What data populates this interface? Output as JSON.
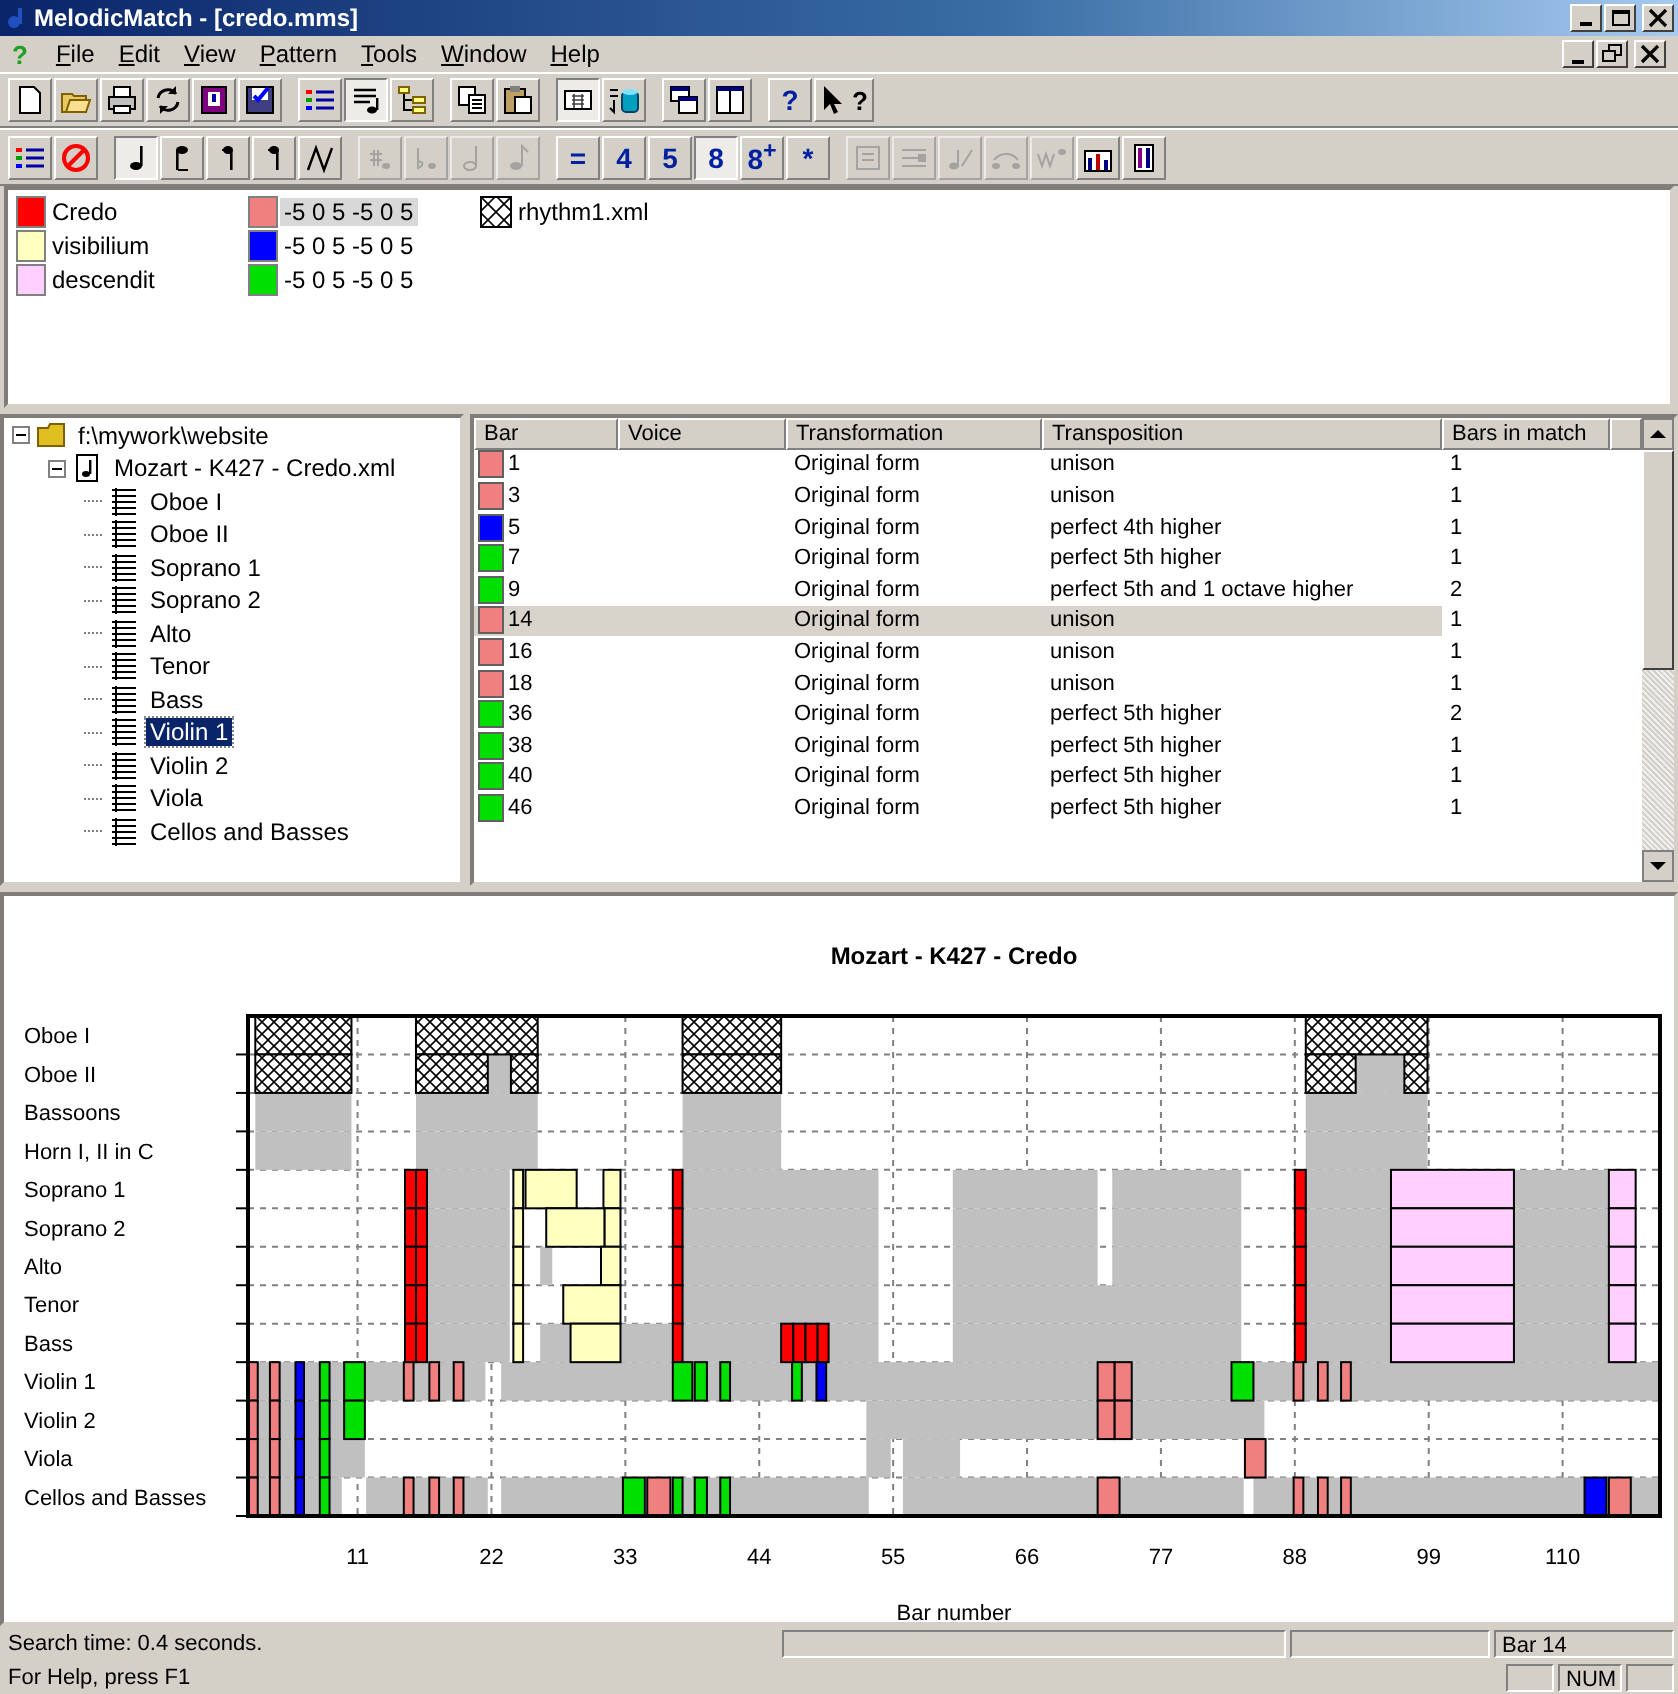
{
  "window": {
    "title": "MelodicMatch - [credo.mms]"
  },
  "menu": {
    "app_glyph": "?",
    "items": [
      "File",
      "Edit",
      "View",
      "Pattern",
      "Tools",
      "Window",
      "Help"
    ]
  },
  "toolbars": [
    [
      [
        {
          "kind": "new",
          "pressed": false,
          "disabled": false
        },
        {
          "kind": "open",
          "pressed": false,
          "disabled": false
        },
        {
          "kind": "print",
          "pressed": false,
          "disabled": false
        },
        {
          "kind": "refresh",
          "pressed": false,
          "disabled": false
        },
        {
          "kind": "helpbook",
          "pressed": false,
          "disabled": false
        },
        {
          "kind": "save",
          "pressed": false,
          "disabled": false
        }
      ],
      [
        {
          "kind": "colorlist",
          "pressed": false,
          "disabled": false
        },
        {
          "kind": "notelist",
          "pressed": true,
          "disabled": false
        },
        {
          "kind": "tree",
          "pressed": false,
          "disabled": false
        }
      ],
      [
        {
          "kind": "copy",
          "pressed": false,
          "disabled": false
        },
        {
          "kind": "paste",
          "pressed": false,
          "disabled": false
        }
      ],
      [
        {
          "kind": "grid",
          "pressed": true,
          "disabled": false
        },
        {
          "kind": "database",
          "pressed": false,
          "disabled": false
        }
      ],
      [
        {
          "kind": "cascade",
          "pressed": false,
          "disabled": false
        },
        {
          "kind": "tile",
          "pressed": false,
          "disabled": false
        }
      ],
      [
        {
          "kind": "text",
          "label": "?",
          "pressed": false,
          "disabled": false
        },
        {
          "kind": "whatsthis",
          "label": "?",
          "pressed": false,
          "disabled": false
        }
      ]
    ],
    [
      [
        {
          "kind": "colorlist",
          "pressed": false,
          "disabled": false
        },
        {
          "kind": "nosign",
          "pressed": false,
          "disabled": false
        }
      ],
      [
        {
          "kind": "quarter",
          "pressed": true,
          "disabled": false
        },
        {
          "kind": "notedown",
          "pressed": false,
          "disabled": false
        },
        {
          "kind": "noteflag",
          "pressed": false,
          "disabled": false
        },
        {
          "kind": "noteflag",
          "pressed": false,
          "disabled": false
        },
        {
          "kind": "zigzag",
          "pressed": false,
          "disabled": false
        }
      ],
      [
        {
          "kind": "sharp",
          "pressed": false,
          "disabled": true
        },
        {
          "kind": "flat",
          "pressed": false,
          "disabled": true
        },
        {
          "kind": "half",
          "pressed": false,
          "disabled": true
        },
        {
          "kind": "eighth",
          "pressed": false,
          "disabled": true
        }
      ],
      [
        {
          "kind": "text",
          "label": "=",
          "pressed": false,
          "disabled": false
        },
        {
          "kind": "text",
          "label": "4",
          "pressed": false,
          "disabled": false
        },
        {
          "kind": "text",
          "label": "5",
          "pressed": false,
          "disabled": false
        },
        {
          "kind": "text",
          "label": "8",
          "pressed": true,
          "disabled": false
        },
        {
          "kind": "text",
          "label": "8$^{+}$",
          "pressed": false,
          "disabled": false
        },
        {
          "kind": "text",
          "label": "*",
          "pressed": false,
          "disabled": false
        }
      ],
      [
        {
          "kind": "card",
          "pressed": false,
          "disabled": true
        },
        {
          "kind": "lines",
          "pressed": false,
          "disabled": true
        },
        {
          "kind": "notex",
          "pressed": false,
          "disabled": true
        },
        {
          "kind": "tie",
          "pressed": false,
          "disabled": true
        },
        {
          "kind": "wave",
          "pressed": false,
          "disabled": true
        },
        {
          "kind": "bars",
          "pressed": false,
          "disabled": false
        },
        {
          "kind": "bars2",
          "pressed": false,
          "disabled": false
        }
      ]
    ]
  ],
  "legend": [
    [
      {
        "kind": "swatch",
        "label": "Credo",
        "color": "#ff0000",
        "selected": false
      },
      {
        "kind": "swatch",
        "label": "visibilium",
        "color": "#ffffc0",
        "selected": false
      },
      {
        "kind": "swatch",
        "label": "descendit",
        "color": "#ffd0ff",
        "selected": false
      }
    ],
    [
      {
        "kind": "swatch",
        "label": "-5 0 5 -5 0 5",
        "color": "#f08080",
        "selected": true
      },
      {
        "kind": "swatch",
        "label": "-5 0 5 -5 0 5",
        "color": "#0000ff",
        "selected": false
      },
      {
        "kind": "swatch",
        "label": "-5 0 5 -5 0 5",
        "color": "#00e000",
        "selected": false
      }
    ],
    [
      {
        "kind": "hatch",
        "label": "rhythm1.xml",
        "selected": false
      }
    ]
  ],
  "tree": [
    {
      "kind": "folder",
      "label": "f:\\mywork\\website",
      "expanded": true,
      "selected": false,
      "children": [
        {
          "kind": "score",
          "label": "Mozart - K427 - Credo.xml",
          "expanded": true,
          "selected": false,
          "children": [
            {
              "kind": "part",
              "label": "Oboe I",
              "selected": false
            },
            {
              "kind": "part",
              "label": "Oboe II",
              "selected": false
            },
            {
              "kind": "part",
              "label": "Soprano 1",
              "selected": false
            },
            {
              "kind": "part",
              "label": "Soprano 2",
              "selected": false
            },
            {
              "kind": "part",
              "label": "Alto",
              "selected": false
            },
            {
              "kind": "part",
              "label": "Tenor",
              "selected": false
            },
            {
              "kind": "part",
              "label": "Bass",
              "selected": false
            },
            {
              "kind": "part",
              "label": "Violin 1",
              "selected": true
            },
            {
              "kind": "part",
              "label": "Violin 2",
              "selected": false
            },
            {
              "kind": "part",
              "label": "Viola",
              "selected": false
            },
            {
              "kind": "part",
              "label": "Cellos and Basses",
              "selected": false
            }
          ]
        }
      ]
    }
  ],
  "table": {
    "columns": [
      "Bar",
      "Voice",
      "Transformation",
      "Transposition",
      "Bars in match"
    ],
    "rows": [
      {
        "color": "#f08080",
        "bar": "1",
        "transformation": "Original form",
        "transposition": "unison",
        "bars_in_match": "1",
        "selected": false
      },
      {
        "color": "#f08080",
        "bar": "3",
        "transformation": "Original form",
        "transposition": "unison",
        "bars_in_match": "1",
        "selected": false
      },
      {
        "color": "#0000ff",
        "bar": "5",
        "transformation": "Original form",
        "transposition": "perfect 4th  higher",
        "bars_in_match": "1",
        "selected": false
      },
      {
        "color": "#00e000",
        "bar": "7",
        "transformation": "Original form",
        "transposition": "perfect 5th  higher",
        "bars_in_match": "1",
        "selected": false
      },
      {
        "color": "#00e000",
        "bar": "9",
        "transformation": "Original form",
        "transposition": "perfect 5th and 1 octave higher",
        "bars_in_match": "2",
        "selected": false
      },
      {
        "color": "#f08080",
        "bar": "14",
        "transformation": "Original form",
        "transposition": "unison",
        "bars_in_match": "1",
        "selected": true
      },
      {
        "color": "#f08080",
        "bar": "16",
        "transformation": "Original form",
        "transposition": "unison",
        "bars_in_match": "1",
        "selected": false
      },
      {
        "color": "#f08080",
        "bar": "18",
        "transformation": "Original form",
        "transposition": "unison",
        "bars_in_match": "1",
        "selected": false
      },
      {
        "color": "#00e000",
        "bar": "36",
        "transformation": "Original form",
        "transposition": "perfect 5th  higher",
        "bars_in_match": "2",
        "selected": false
      },
      {
        "color": "#00e000",
        "bar": "38",
        "transformation": "Original form",
        "transposition": "perfect 5th  higher",
        "bars_in_match": "1",
        "selected": false
      },
      {
        "color": "#00e000",
        "bar": "40",
        "transformation": "Original form",
        "transposition": "perfect 5th  higher",
        "bars_in_match": "1",
        "selected": false
      },
      {
        "color": "#00e000",
        "bar": "46",
        "transformation": "Original form",
        "transposition": "perfect 5th  higher",
        "bars_in_match": "1",
        "selected": false
      }
    ]
  },
  "match_map": {
    "title": "Mozart - K427 - Credo",
    "rows": [
      "Oboe I",
      "Oboe II",
      "Bassoons",
      "Horn I, II in C",
      "Soprano 1",
      "Soprano 2",
      "Alto",
      "Tenor",
      "Bass",
      "Violin 1",
      "Violin 2",
      "Viola",
      "Cellos and Basses"
    ],
    "ticks": [
      "11",
      "22",
      "33",
      "44",
      "55",
      "66",
      "77",
      "88",
      "99",
      "110"
    ],
    "axis_title": "Bar number"
  },
  "status_bar": {
    "message": "Search time: 0.4 seconds.",
    "position": "Bar 14",
    "help": "For Help, press F1",
    "indicator": "NUM"
  }
}
